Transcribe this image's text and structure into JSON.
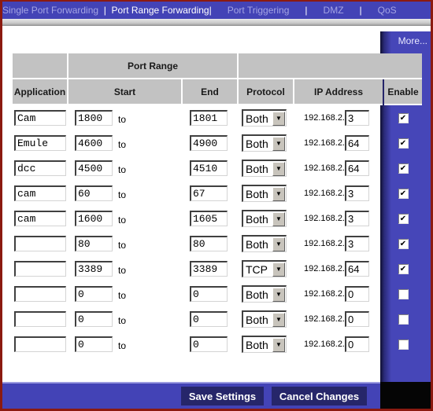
{
  "nav": {
    "items": [
      {
        "label": "Single Port Forwarding",
        "active": false
      },
      {
        "label": "Port Range Forwarding",
        "active": true
      },
      {
        "label": "Port Triggering",
        "active": false
      },
      {
        "label": "DMZ",
        "active": false
      },
      {
        "label": "QoS",
        "active": false
      }
    ],
    "separator": "|"
  },
  "side": {
    "more_label": "More..."
  },
  "table": {
    "group_header": "Port Range",
    "headers": {
      "application": "Application",
      "start": "Start",
      "end": "End",
      "protocol": "Protocol",
      "ip": "IP Address",
      "enable": "Enable"
    },
    "to_label": "to",
    "ip_prefix": "192.168.2.",
    "rows": [
      {
        "application": "Cam",
        "start": "1800",
        "end": "1801",
        "protocol": "Both",
        "ip_last": "3",
        "enabled": true
      },
      {
        "application": "Emule",
        "start": "4600",
        "end": "4900",
        "protocol": "Both",
        "ip_last": "64",
        "enabled": true
      },
      {
        "application": "dcc",
        "start": "4500",
        "end": "4510",
        "protocol": "Both",
        "ip_last": "64",
        "enabled": true
      },
      {
        "application": "cam",
        "start": "60",
        "end": "67",
        "protocol": "Both",
        "ip_last": "3",
        "enabled": true
      },
      {
        "application": "cam",
        "start": "1600",
        "end": "1605",
        "protocol": "Both",
        "ip_last": "3",
        "enabled": true
      },
      {
        "application": "",
        "start": "80",
        "end": "80",
        "protocol": "Both",
        "ip_last": "3",
        "enabled": true
      },
      {
        "application": "",
        "start": "3389",
        "end": "3389",
        "protocol": "TCP",
        "ip_last": "64",
        "enabled": true
      },
      {
        "application": "",
        "start": "0",
        "end": "0",
        "protocol": "Both",
        "ip_last": "0",
        "enabled": false
      },
      {
        "application": "",
        "start": "0",
        "end": "0",
        "protocol": "Both",
        "ip_last": "0",
        "enabled": false
      },
      {
        "application": "",
        "start": "0",
        "end": "0",
        "protocol": "Both",
        "ip_last": "0",
        "enabled": false
      }
    ]
  },
  "buttons": {
    "save": "Save Settings",
    "cancel": "Cancel Changes"
  },
  "icons": {
    "dropdown_arrow": "▼",
    "checkmark": "✔"
  }
}
